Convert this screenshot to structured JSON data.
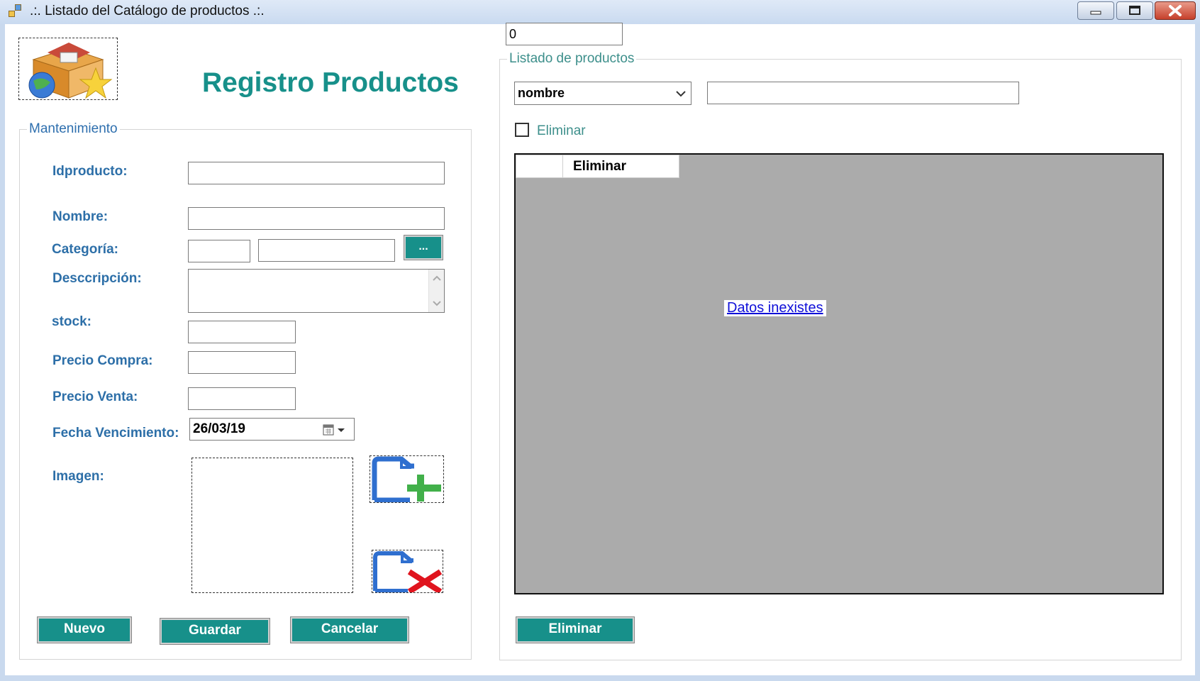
{
  "window": {
    "title": ".:. Listado del Catálogo de productos .:.",
    "minimize_icon": "minimize-icon",
    "maximize_icon": "restore-icon",
    "close_icon": "close-icon"
  },
  "header": {
    "logo_icon": "product-box-icon",
    "heading": "Registro Productos"
  },
  "mantenimiento": {
    "group_title": "Mantenimiento",
    "fields": {
      "idproducto_label": "Idproducto:",
      "idproducto_value": "",
      "nombre_label": "Nombre:",
      "nombre_value": "",
      "categoria_label": "Categoría:",
      "categoria_id_value": "",
      "categoria_name_value": "",
      "categoria_browse_label": "...",
      "descripcion_label": "Desccripción:",
      "descripcion_value": "",
      "stock_label": "stock:",
      "stock_value": "",
      "precio_compra_label": "Precio Compra:",
      "precio_compra_value": "",
      "precio_venta_label": "Precio Venta:",
      "precio_venta_value": "",
      "fecha_label": "Fecha Vencimiento:",
      "fecha_value": "26/03/19",
      "imagen_label": "Imagen:"
    },
    "add_image_icon": "add-file-icon",
    "remove_image_icon": "remove-file-icon",
    "buttons": {
      "nuevo": "Nuevo",
      "guardar": "Guardar",
      "cancelar": "Cancelar"
    }
  },
  "listado": {
    "counter_value": "0",
    "group_title": "Listado de productos",
    "search_field_selected": "nombre",
    "search_value": "",
    "eliminar_checkbox_label": "Eliminar",
    "eliminar_checked": false,
    "grid_columns": [
      "Eliminar"
    ],
    "empty_message": "Datos inexistes",
    "eliminar_button": "Eliminar"
  },
  "colors": {
    "accent": "#17908a",
    "label": "#2d6fa8",
    "grid_background": "#ababab"
  }
}
